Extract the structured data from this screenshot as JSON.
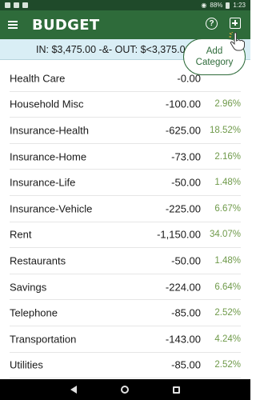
{
  "status": {
    "battery": "88%",
    "time": "1:23"
  },
  "app": {
    "title": "BUDGET",
    "help_glyph": "?"
  },
  "summary": {
    "text": "IN: $3,475.00 -&- OUT: $<3,375.00>"
  },
  "tooltip": {
    "line1": "Add",
    "line2": "Category"
  },
  "rows": [
    {
      "name": "Health Care",
      "amount": "-0.00",
      "pct": ""
    },
    {
      "name": "Household Misc",
      "amount": "-100.00",
      "pct": "2.96%"
    },
    {
      "name": "Insurance-Health",
      "amount": "-625.00",
      "pct": "18.52%"
    },
    {
      "name": "Insurance-Home",
      "amount": "-73.00",
      "pct": "2.16%"
    },
    {
      "name": "Insurance-Life",
      "amount": "-50.00",
      "pct": "1.48%"
    },
    {
      "name": "Insurance-Vehicle",
      "amount": "-225.00",
      "pct": "6.67%"
    },
    {
      "name": "Rent",
      "amount": "-1,150.00",
      "pct": "34.07%"
    },
    {
      "name": "Restaurants",
      "amount": "-50.00",
      "pct": "1.48%"
    },
    {
      "name": "Savings",
      "amount": "-224.00",
      "pct": "6.64%"
    },
    {
      "name": "Telephone",
      "amount": "-85.00",
      "pct": "2.52%"
    },
    {
      "name": "Transportation",
      "amount": "-143.00",
      "pct": "4.24%"
    },
    {
      "name": "Utilities",
      "amount": "-85.00",
      "pct": "2.52%"
    }
  ],
  "colors": {
    "app_bar": "#2e6b3a",
    "summary_bg": "#d9eef5",
    "percent_text": "#6f9a4a"
  },
  "icons": {
    "menu": "hamburger-menu-icon",
    "help": "help-icon",
    "add": "add-category-icon",
    "nav_back": "back-icon",
    "nav_home": "home-icon",
    "nav_recent": "recent-apps-icon"
  }
}
